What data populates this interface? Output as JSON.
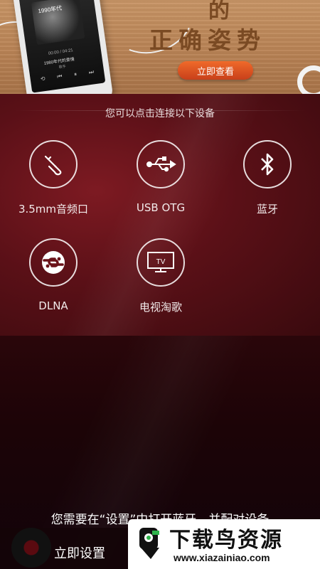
{
  "banner": {
    "title_top": "的",
    "title": "正确姿势",
    "cta_label": "立即查看",
    "phone": {
      "album_title": "1990年代",
      "time": "00:00 / 04:21",
      "song": "1980年代的爱情",
      "artist": "歌手"
    }
  },
  "panel": {
    "header": "您可以点击连接以下设备",
    "devices": [
      {
        "label": "3.5mm音频口",
        "icon": "headphone-jack-icon"
      },
      {
        "label": "USB OTG",
        "icon": "usb-icon"
      },
      {
        "label": "蓝牙",
        "icon": "bluetooth-icon"
      },
      {
        "label": "DLNA",
        "icon": "dlna-icon"
      },
      {
        "label": "电视淘歌",
        "icon": "tv-icon"
      }
    ]
  },
  "notice": "您需要在“设置”中打开蓝牙，并配对设备",
  "bottom": {
    "setup_label": "立即设置"
  },
  "watermark": {
    "title": "下载鸟资源",
    "url": "www.xiazainiao.com"
  },
  "colors": {
    "panel_bg": "#5a1017",
    "cta_orange": "#e0561f",
    "banner_text": "#7a4a23"
  }
}
